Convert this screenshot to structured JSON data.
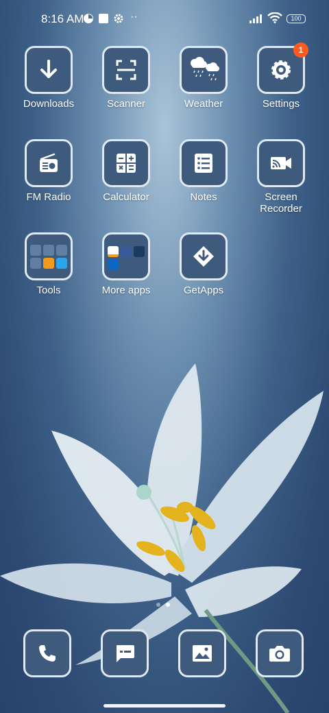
{
  "status_bar": {
    "time": "8:16 AM",
    "overflow_dots": "··",
    "battery": "100"
  },
  "apps": [
    {
      "label": "Downloads",
      "icon": "download-icon"
    },
    {
      "label": "Scanner",
      "icon": "scanner-icon"
    },
    {
      "label": "Weather",
      "icon": "weather-icon"
    },
    {
      "label": "Settings",
      "icon": "settings-icon",
      "badge": "1"
    },
    {
      "label": "FM Radio",
      "icon": "radio-icon"
    },
    {
      "label": "Calculator",
      "icon": "calculator-icon"
    },
    {
      "label": "Notes",
      "icon": "notes-icon"
    },
    {
      "label": "Screen Recorder",
      "label_line1": "Screen",
      "label_line2": "Recorder",
      "icon": "screen-recorder-icon"
    },
    {
      "label": "Tools",
      "icon": "folder-icon"
    },
    {
      "label": "More apps",
      "icon": "folder-icon"
    },
    {
      "label": "GetApps",
      "icon": "getapps-icon"
    }
  ],
  "dock": [
    {
      "icon": "phone-icon"
    },
    {
      "icon": "messages-icon"
    },
    {
      "icon": "gallery-icon"
    },
    {
      "icon": "camera-icon"
    }
  ],
  "page_indicator": {
    "pages": 2,
    "active": 2
  },
  "colors": {
    "tile_bg": "#3e5a7d",
    "tile_border": "#dfe9f1",
    "badge": "#ff5a1f"
  }
}
